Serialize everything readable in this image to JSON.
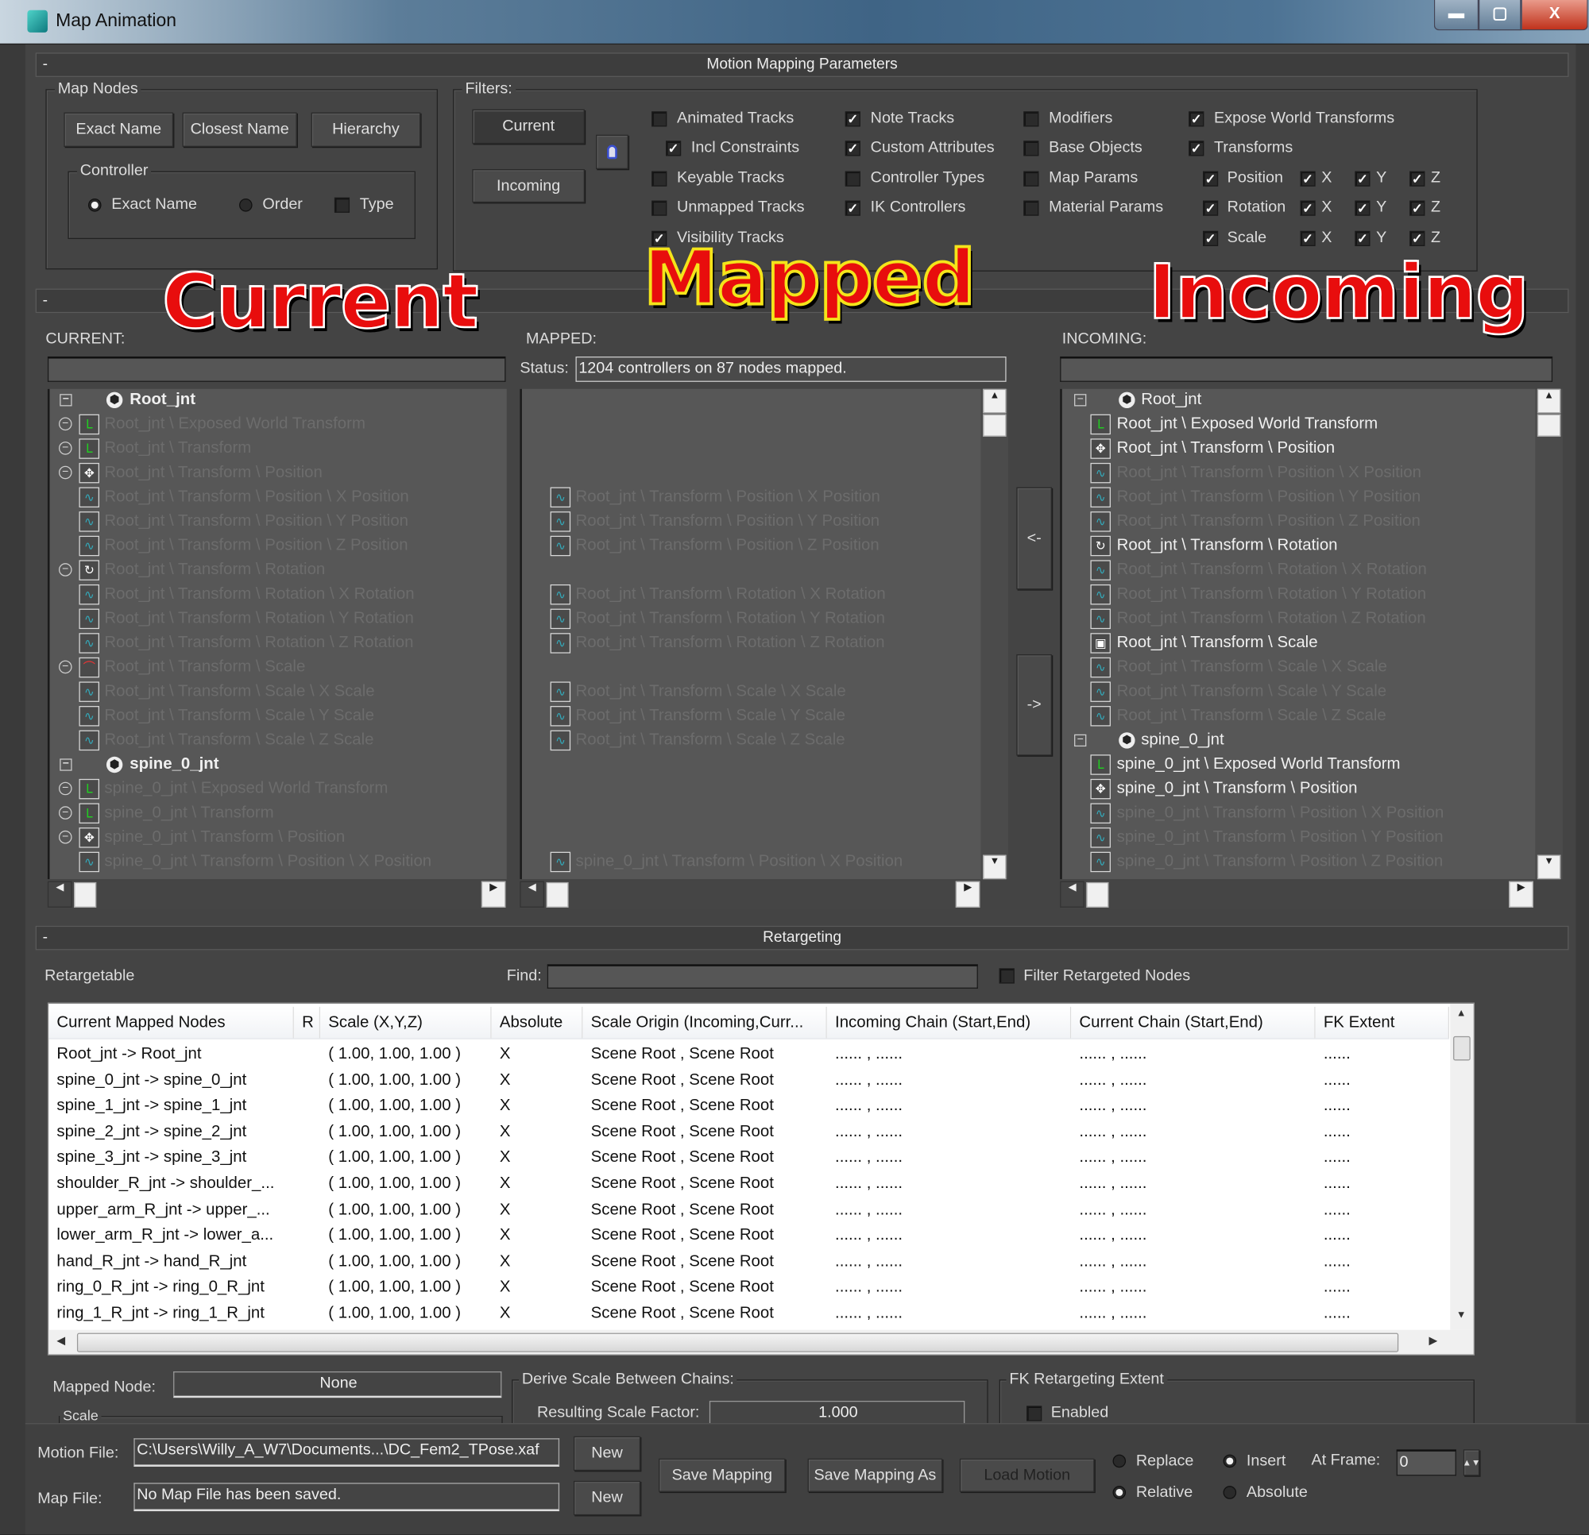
{
  "window": {
    "title": "Map Animation",
    "minimize": "▬",
    "maximize": "▢",
    "close": "X"
  },
  "motion_mapping": {
    "header": "Motion Mapping Parameters",
    "collapse": "-",
    "map_nodes": {
      "label": "Map Nodes",
      "buttons": [
        "Exact Name",
        "Closest Name",
        "Hierarchy"
      ],
      "controller": {
        "label": "Controller",
        "exact_name": "Exact Name",
        "exact_name_selected": true,
        "order": "Order",
        "order_selected": false,
        "type": "Type",
        "type_checked": false
      }
    },
    "filters": {
      "label": "Filters:",
      "current_button": "Current",
      "incoming_button": "Incoming",
      "lock_icon": "lock-icon",
      "checkboxes": [
        {
          "label": "Animated Tracks",
          "checked": false
        },
        {
          "label": "Incl Constraints",
          "checked": true
        },
        {
          "label": "Keyable Tracks",
          "checked": false
        },
        {
          "label": "Unmapped Tracks",
          "checked": false
        },
        {
          "label": "Visibility Tracks",
          "checked": true
        },
        {
          "label": "Note Tracks",
          "checked": true
        },
        {
          "label": "Custom Attributes",
          "checked": true
        },
        {
          "label": "Controller Types",
          "checked": false
        },
        {
          "label": "IK Controllers",
          "checked": true
        },
        {
          "label": "Modifiers",
          "checked": false
        },
        {
          "label": "Base Objects",
          "checked": false
        },
        {
          "label": "Map Params",
          "checked": false
        },
        {
          "label": "Material Params",
          "checked": false
        },
        {
          "label": "Expose World Transforms",
          "checked": true
        },
        {
          "label": "Transforms",
          "checked": true
        }
      ],
      "transform_rows": [
        {
          "label": "Position",
          "checked": true,
          "x": true,
          "y": true,
          "z": true
        },
        {
          "label": "Rotation",
          "checked": true,
          "x": true,
          "y": true,
          "z": true
        },
        {
          "label": "Scale",
          "checked": true,
          "x": true,
          "y": true,
          "z": true
        }
      ],
      "axis_labels": [
        "X",
        "Y",
        "Z"
      ]
    }
  },
  "annotations": {
    "current": "Current",
    "mapped": "Mapped",
    "incoming": "Incoming"
  },
  "lists": {
    "collapse": "-",
    "current_label": "CURRENT:",
    "mapped_label": "MAPPED:",
    "incoming_label": "INCOMING:",
    "status_label": "Status:",
    "status_value": "1204 controllers on 87 nodes mapped.",
    "map_left_button": "<-",
    "map_right_button": "->",
    "current_tree": [
      {
        "kind": "node",
        "text": "Root_jnt"
      },
      {
        "kind": "ctrl",
        "icon": "xform",
        "collapse": true,
        "text": "Root_jnt \\ Exposed World Transform"
      },
      {
        "kind": "ctrl",
        "icon": "xform",
        "collapse": true,
        "text": "Root_jnt \\ Transform"
      },
      {
        "kind": "ctrl",
        "icon": "position",
        "collapse": true,
        "text": "Root_jnt \\ Transform \\ Position"
      },
      {
        "kind": "ctrl",
        "icon": "curve",
        "text": "Root_jnt \\ Transform \\ Position \\ X Position"
      },
      {
        "kind": "ctrl",
        "icon": "curve",
        "text": "Root_jnt \\ Transform \\ Position \\ Y Position"
      },
      {
        "kind": "ctrl",
        "icon": "curve",
        "text": "Root_jnt \\ Transform \\ Position \\ Z Position"
      },
      {
        "kind": "ctrl",
        "icon": "rotation",
        "collapse": true,
        "text": "Root_jnt \\ Transform \\ Rotation"
      },
      {
        "kind": "ctrl",
        "icon": "curve",
        "text": "Root_jnt \\ Transform \\ Rotation \\ X Rotation"
      },
      {
        "kind": "ctrl",
        "icon": "curve",
        "text": "Root_jnt \\ Transform \\ Rotation \\ Y Rotation"
      },
      {
        "kind": "ctrl",
        "icon": "curve",
        "text": "Root_jnt \\ Transform \\ Rotation \\ Z Rotation"
      },
      {
        "kind": "ctrl",
        "icon": "scale-curves",
        "collapse": true,
        "text": "Root_jnt \\ Transform \\ Scale"
      },
      {
        "kind": "ctrl",
        "icon": "curve",
        "text": "Root_jnt \\ Transform \\ Scale \\ X Scale"
      },
      {
        "kind": "ctrl",
        "icon": "curve",
        "text": "Root_jnt \\ Transform \\ Scale \\ Y Scale"
      },
      {
        "kind": "ctrl",
        "icon": "curve",
        "text": "Root_jnt \\ Transform \\ Scale \\ Z Scale"
      },
      {
        "kind": "node",
        "text": "spine_0_jnt"
      },
      {
        "kind": "ctrl",
        "icon": "xform",
        "collapse": true,
        "text": "spine_0_jnt \\ Exposed World Transform"
      },
      {
        "kind": "ctrl",
        "icon": "xform",
        "collapse": true,
        "text": "spine_0_jnt \\ Transform"
      },
      {
        "kind": "ctrl",
        "icon": "position",
        "collapse": true,
        "text": "spine_0_jnt \\ Transform \\ Position"
      },
      {
        "kind": "ctrl",
        "icon": "curve",
        "text": "spine_0_jnt \\ Transform \\ Position \\ X Position"
      }
    ],
    "mapped_list": [
      "",
      "",
      "",
      "",
      "Root_jnt \\ Transform \\ Position \\ X Position",
      "Root_jnt \\ Transform \\ Position \\ Y Position",
      "Root_jnt \\ Transform \\ Position \\ Z Position",
      "",
      "Root_jnt \\ Transform \\ Rotation \\ X Rotation",
      "Root_jnt \\ Transform \\ Rotation \\ Y Rotation",
      "Root_jnt \\ Transform \\ Rotation \\ Z Rotation",
      "",
      "Root_jnt \\ Transform \\ Scale \\ X Scale",
      "Root_jnt \\ Transform \\ Scale \\ Y Scale",
      "Root_jnt \\ Transform \\ Scale \\ Z Scale",
      "",
      "",
      "",
      "",
      "spine_0_jnt \\ Transform \\ Position \\ X Position"
    ],
    "incoming_tree": [
      {
        "kind": "node",
        "text": "Root_jnt"
      },
      {
        "kind": "ctrl",
        "icon": "xform",
        "mapped": true,
        "text": "Root_jnt \\ Exposed World Transform"
      },
      {
        "kind": "ctrl",
        "icon": "position",
        "mapped": true,
        "text": "Root_jnt \\ Transform \\ Position"
      },
      {
        "kind": "ctrl",
        "icon": "curve",
        "text": "Root_jnt \\ Transform \\ Position \\ X Position"
      },
      {
        "kind": "ctrl",
        "icon": "curve",
        "text": "Root_jnt \\ Transform \\ Position \\ Y Position"
      },
      {
        "kind": "ctrl",
        "icon": "curve",
        "text": "Root_jnt \\ Transform \\ Position \\ Z Position"
      },
      {
        "kind": "ctrl",
        "icon": "rotation",
        "mapped": true,
        "text": "Root_jnt \\ Transform \\ Rotation"
      },
      {
        "kind": "ctrl",
        "icon": "curve",
        "text": "Root_jnt \\ Transform \\ Rotation \\ X Rotation"
      },
      {
        "kind": "ctrl",
        "icon": "curve",
        "text": "Root_jnt \\ Transform \\ Rotation \\ Y Rotation"
      },
      {
        "kind": "ctrl",
        "icon": "curve",
        "text": "Root_jnt \\ Transform \\ Rotation \\ Z Rotation"
      },
      {
        "kind": "ctrl",
        "icon": "scale",
        "mapped": true,
        "text": "Root_jnt \\ Transform \\ Scale"
      },
      {
        "kind": "ctrl",
        "icon": "curve",
        "text": "Root_jnt \\ Transform \\ Scale \\ X Scale"
      },
      {
        "kind": "ctrl",
        "icon": "curve",
        "text": "Root_jnt \\ Transform \\ Scale \\ Y Scale"
      },
      {
        "kind": "ctrl",
        "icon": "curve",
        "text": "Root_jnt \\ Transform \\ Scale \\ Z Scale"
      },
      {
        "kind": "node",
        "text": "spine_0_jnt"
      },
      {
        "kind": "ctrl",
        "icon": "xform",
        "mapped": true,
        "text": "spine_0_jnt \\ Exposed World Transform"
      },
      {
        "kind": "ctrl",
        "icon": "position",
        "mapped": true,
        "text": "spine_0_jnt \\ Transform \\ Position"
      },
      {
        "kind": "ctrl",
        "icon": "curve",
        "text": "spine_0_jnt \\ Transform \\ Position \\ X Position"
      },
      {
        "kind": "ctrl",
        "icon": "curve",
        "text": "spine_0_jnt \\ Transform \\ Position \\ Y Position"
      },
      {
        "kind": "ctrl",
        "icon": "curve",
        "text": "spine_0_jnt \\ Transform \\ Position \\ Z Position"
      }
    ]
  },
  "retargeting": {
    "header": "Retargeting",
    "collapse": "-",
    "retargetable_label": "Retargetable",
    "find_label": "Find:",
    "find_value": "",
    "filter_label": "Filter Retargeted Nodes",
    "filter_checked": false,
    "columns": [
      "Current Mapped Nodes",
      "R",
      "Scale (X,Y,Z)",
      "Absolute",
      "Scale Origin (Incoming,Curr...",
      "Incoming Chain (Start,End)",
      "Current Chain (Start,End)",
      "FK Extent"
    ],
    "rows": [
      [
        "Root_jnt -> Root_jnt",
        "",
        "( 1.00, 1.00, 1.00 )",
        "X",
        "Scene Root , Scene Root",
        "...... , ......",
        "...... , ......",
        "......"
      ],
      [
        "spine_0_jnt -> spine_0_jnt",
        "",
        "( 1.00, 1.00, 1.00 )",
        "X",
        "Scene Root , Scene Root",
        "...... , ......",
        "...... , ......",
        "......"
      ],
      [
        "spine_1_jnt -> spine_1_jnt",
        "",
        "( 1.00, 1.00, 1.00 )",
        "X",
        "Scene Root , Scene Root",
        "...... , ......",
        "...... , ......",
        "......"
      ],
      [
        "spine_2_jnt -> spine_2_jnt",
        "",
        "( 1.00, 1.00, 1.00 )",
        "X",
        "Scene Root , Scene Root",
        "...... , ......",
        "...... , ......",
        "......"
      ],
      [
        "spine_3_jnt -> spine_3_jnt",
        "",
        "( 1.00, 1.00, 1.00 )",
        "X",
        "Scene Root , Scene Root",
        "...... , ......",
        "...... , ......",
        "......"
      ],
      [
        "shoulder_R_jnt -> shoulder_...",
        "",
        "( 1.00, 1.00, 1.00 )",
        "X",
        "Scene Root , Scene Root",
        "...... , ......",
        "...... , ......",
        "......"
      ],
      [
        "upper_arm_R_jnt -> upper_...",
        "",
        "( 1.00, 1.00, 1.00 )",
        "X",
        "Scene Root , Scene Root",
        "...... , ......",
        "...... , ......",
        "......"
      ],
      [
        "lower_arm_R_jnt -> lower_a...",
        "",
        "( 1.00, 1.00, 1.00 )",
        "X",
        "Scene Root , Scene Root",
        "...... , ......",
        "...... , ......",
        "......"
      ],
      [
        "hand_R_jnt -> hand_R_jnt",
        "",
        "( 1.00, 1.00, 1.00 )",
        "X",
        "Scene Root , Scene Root",
        "...... , ......",
        "...... , ......",
        "......"
      ],
      [
        "ring_0_R_jnt -> ring_0_R_jnt",
        "",
        "( 1.00, 1.00, 1.00 )",
        "X",
        "Scene Root , Scene Root",
        "...... , ......",
        "...... , ......",
        "......"
      ],
      [
        "ring_1_R_jnt -> ring_1_R_jnt",
        "",
        "( 1.00, 1.00, 1.00 )",
        "X",
        "Scene Root , Scene Root",
        "...... , ......",
        "...... , ......",
        "......"
      ]
    ],
    "mapped_node_label": "Mapped Node:",
    "mapped_node_value": "None",
    "scale_group_label": "Scale",
    "derive_label": "Derive Scale Between Chains:",
    "scale_factor_label": "Resulting Scale Factor:",
    "scale_factor_value": "1.000",
    "fk_label": "FK Retargeting Extent",
    "enabled_label": "Enabled",
    "enabled_checked": false
  },
  "footer": {
    "motion_file_label": "Motion File:",
    "motion_file_value": "C:\\Users\\Willy_A_W7\\Documents...\\DC_Fem2_TPose.xaf",
    "map_file_label": "Map File:",
    "map_file_value": "No Map File has been saved.",
    "new_label": "New",
    "save_mapping": "Save Mapping",
    "save_mapping_as": "Save Mapping As",
    "load_motion": "Load Motion",
    "replace": "Replace",
    "replace_selected": false,
    "insert": "Insert",
    "insert_selected": true,
    "relative": "Relative",
    "relative_selected": true,
    "absolute": "Absolute",
    "absolute_selected": false,
    "at_frame_label": "At Frame:",
    "at_frame_value": "0"
  }
}
